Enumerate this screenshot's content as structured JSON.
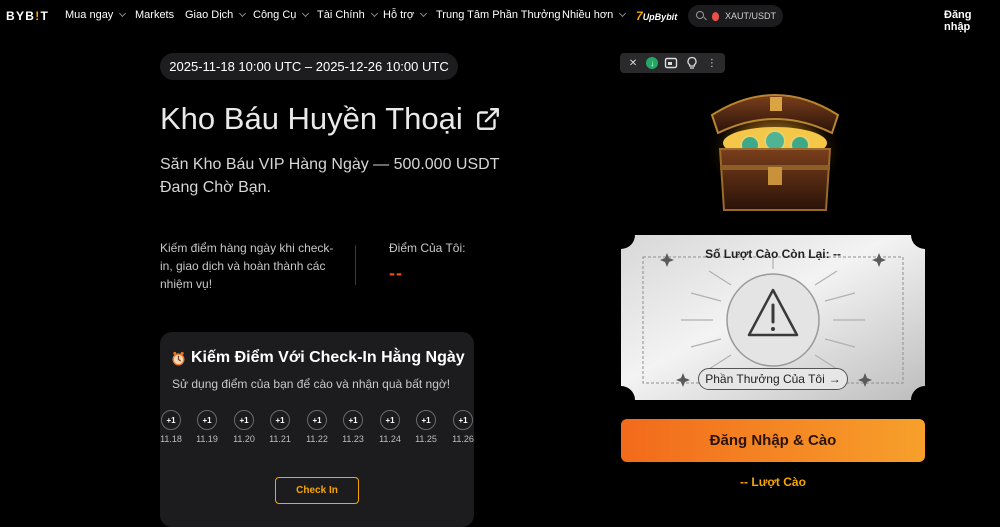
{
  "nav": {
    "logo_a": "BYB",
    "logo_b": "!",
    "logo_c": "T",
    "items": [
      {
        "label": "Mua ngay",
        "dropdown": true
      },
      {
        "label": "Markets",
        "dropdown": false
      },
      {
        "label": "Giao Dịch",
        "dropdown": true
      },
      {
        "label": "Công Cụ",
        "dropdown": true
      },
      {
        "label": "Tài Chính",
        "dropdown": true
      },
      {
        "label": "Hỗ trợ",
        "dropdown": true
      },
      {
        "label": "Trung Tâm Phần Thưởng",
        "dropdown": false
      },
      {
        "label": "Nhiều hơn",
        "dropdown": true
      }
    ],
    "upbybit_num": "7",
    "upbybit_label": "UpBybit",
    "search_text": "XAUT/USDT",
    "login": "Đăng nhập"
  },
  "event": {
    "date_range": "2025-11-18 10:00 UTC – 2025-12-26 10:00 UTC",
    "title": "Kho Báu Huyền Thoại",
    "subtitle": "Săn Kho Báu VIP Hàng Ngày — 500.000 USDT Đang Chờ Bạn.",
    "description": "Kiếm điểm hàng ngày khi check-in, giao dịch và hoàn thành các nhiệm vụ!",
    "points_label": "Điểm Của Tôi:",
    "points_value": "--"
  },
  "checkin": {
    "title": "Kiếm Điểm Với Check-In Hằng Ngày",
    "subtitle": "Sử dụng điểm của bạn để cào và nhận quà bất ngờ!",
    "days": [
      {
        "bonus": "+1",
        "date": "11.18"
      },
      {
        "bonus": "+1",
        "date": "11.19"
      },
      {
        "bonus": "+1",
        "date": "11.20"
      },
      {
        "bonus": "+1",
        "date": "11.21"
      },
      {
        "bonus": "+1",
        "date": "11.22"
      },
      {
        "bonus": "+1",
        "date": "11.23"
      },
      {
        "bonus": "+1",
        "date": "11.24"
      },
      {
        "bonus": "+1",
        "date": "11.25"
      },
      {
        "bonus": "+1",
        "date": "11.26"
      }
    ],
    "button": "Check In"
  },
  "toolbar": {
    "close": "✕",
    "more": "⋮"
  },
  "scratch": {
    "remaining": "Số Lượt Cào Còn Lại: --",
    "reward_link": "Phần Thưởng Của Tôi",
    "reward_arrow": "→",
    "main_button": "Đăng Nhập & Cào",
    "turns": "-- Lượt Cào"
  },
  "colors": {
    "accent_orange": "#f7a600",
    "button_gradient_start": "#f26a1b",
    "points_color": "#f24b17"
  }
}
